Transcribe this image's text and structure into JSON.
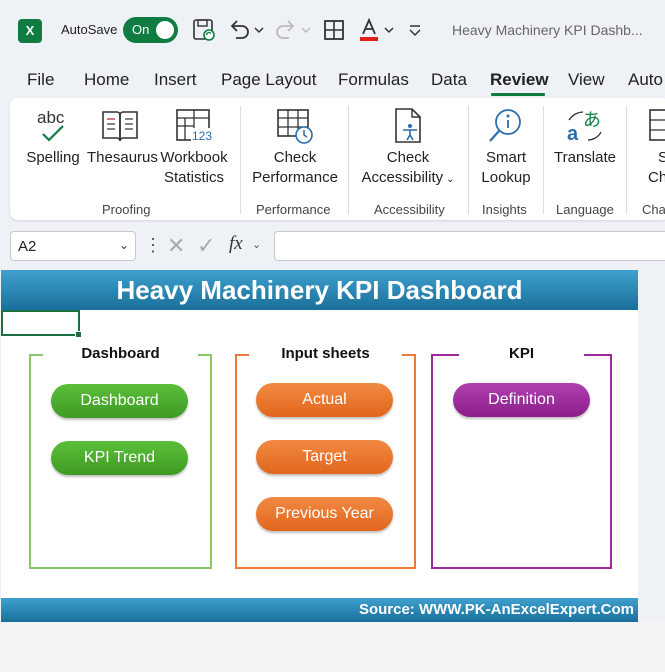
{
  "titlebar": {
    "autosave_label": "AutoSave",
    "autosave_state": "On",
    "doc_title": "Heavy Machinery KPI Dashb..."
  },
  "tabs": [
    "File",
    "Home",
    "Insert",
    "Page Layout",
    "Formulas",
    "Data",
    "Review",
    "View",
    "Auto"
  ],
  "active_tab": "Review",
  "ribbon": {
    "spelling": "Spelling",
    "thesaurus": "Thesaurus",
    "workbook_stats_1": "Workbook",
    "workbook_stats_2": "Statistics",
    "proofing": "Proofing",
    "check_perf_1": "Check",
    "check_perf_2": "Performance",
    "performance": "Performance",
    "check_acc_1": "Check",
    "check_acc_2": "Accessibility",
    "accessibility": "Accessibility",
    "smart_lookup_1": "Smart",
    "smart_lookup_2": "Lookup",
    "insights": "Insights",
    "translate": "Translate",
    "language": "Language",
    "show_changes_1": "Sh",
    "show_changes_2": "Cha",
    "changes": "Cha"
  },
  "formula_bar": {
    "name_box": "A2",
    "fx": "fx",
    "formula_value": ""
  },
  "sheet": {
    "title": "Heavy Machinery KPI Dashboard",
    "footer": "Source: WWW.PK-AnExcelExpert.Com",
    "groups": {
      "dashboard": {
        "title": "Dashboard",
        "buttons": [
          "Dashboard",
          "KPI Trend"
        ]
      },
      "input": {
        "title": "Input sheets",
        "buttons": [
          "Actual",
          "Target",
          "Previous Year"
        ]
      },
      "kpi": {
        "title": "KPI",
        "buttons": [
          "Definition"
        ]
      }
    }
  },
  "colors": {
    "excel_green": "#107c41",
    "banner_blue": "#2385b6",
    "green": "#4caf2e",
    "orange": "#eb7530",
    "purple": "#9b2a9a"
  }
}
